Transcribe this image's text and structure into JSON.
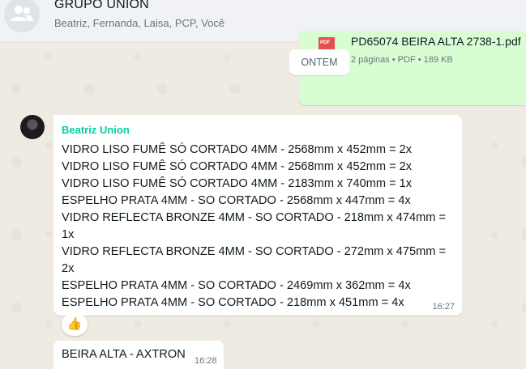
{
  "header": {
    "group_name": "GRUPO UNION",
    "members": "Beatriz, Fernanda, Laisa, PCP, Você"
  },
  "outgoing_file": {
    "filename": "PD65074 BEIRA ALTA 2738-1.pdf",
    "meta": "2 páginas • PDF • 189 KB",
    "icon_label": "PDF"
  },
  "date_divider": "ONTEM",
  "message1": {
    "sender": "Beatriz Union",
    "lines": [
      "VIDRO LISO FUMÊ SÓ CORTADO 4MM - 2568mm x 452mm = 2x",
      "VIDRO LISO FUMÊ SÓ CORTADO 4MM - 2568mm x 452mm = 2x",
      "VIDRO LISO FUMÊ SÓ CORTADO 4MM - 2183mm x 740mm = 1x",
      "ESPELHO PRATA 4MM - SO CORTADO - 2568mm x 447mm = 4x",
      "VIDRO REFLECTA BRONZE 4MM - SO CORTADO - 218mm x 474mm =",
      "1x",
      "VIDRO REFLECTA BRONZE 4MM - SO CORTADO - 272mm x 475mm =",
      "2x",
      "ESPELHO PRATA 4MM - SO CORTADO - 2469mm x 362mm = 4x",
      "ESPELHO PRATA 4MM - SO CORTADO - 218mm x 451mm = 4x"
    ],
    "time": "16:27",
    "reaction": "👍"
  },
  "message2": {
    "text": "BEIRA ALTA - AXTRON",
    "time": "16:28"
  },
  "colors": {
    "sender_name": "#06cf9c",
    "outgoing_bubble": "#d9fdd3",
    "background": "#efeae2"
  }
}
